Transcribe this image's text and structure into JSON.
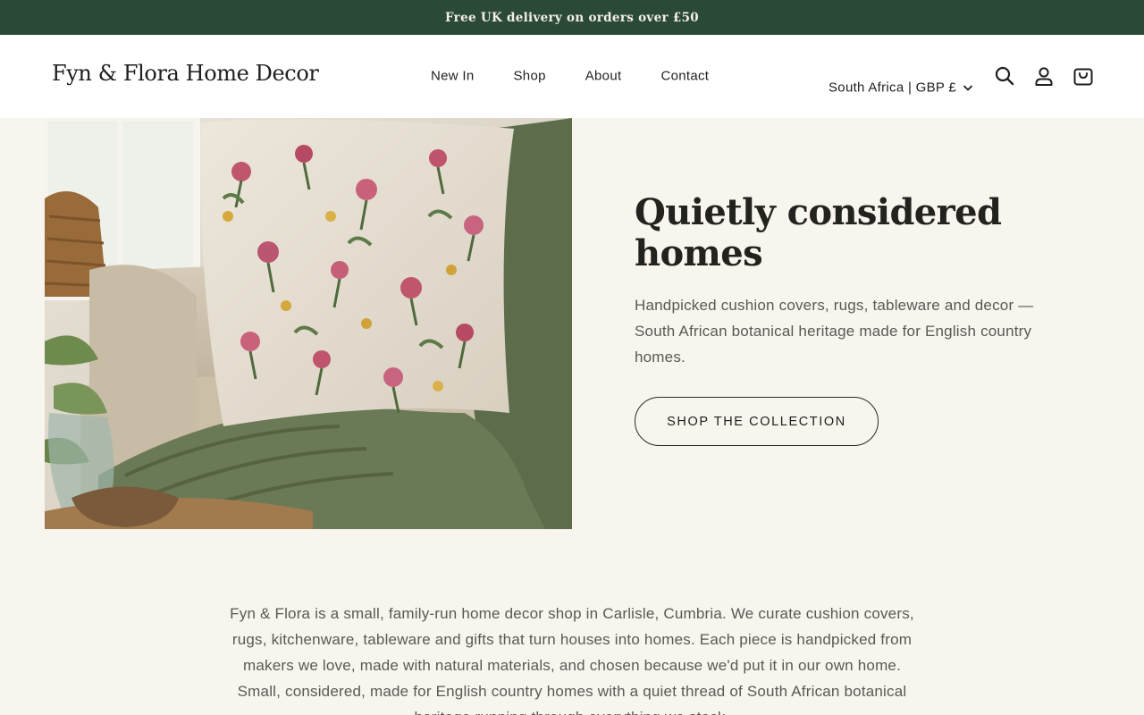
{
  "announcement": "Free UK delivery on orders over £50",
  "header": {
    "logo": "Fyn & Flora Home Decor",
    "nav": [
      "New In",
      "Shop",
      "About",
      "Contact"
    ],
    "locale": "South Africa | GBP £",
    "icons": [
      "search-icon",
      "account-icon",
      "cart-icon",
      "chevron-down-icon"
    ]
  },
  "hero": {
    "title": "Quietly considered homes",
    "description": "Handpicked cushion covers, rugs, tableware and decor — South African botanical heritage made for English country homes.",
    "cta": "SHOP THE COLLECTION"
  },
  "about": {
    "text": "Fyn & Flora is a small, family-run home decor shop in Carlisle, Cumbria. We curate cushion covers, rugs, kitchenware, tableware and gifts that turn houses into homes. Each piece is handpicked from makers we love, made with natural materials, and chosen because we'd put it in our own home. Small, considered, made for English country homes with a quiet thread of South African botanical heritage running through everything we stock."
  },
  "colors": {
    "announcement_bg": "#2a4a37",
    "page_bg": "#f8f4ee",
    "text_dark": "#1f1f1f",
    "text_muted": "#5b5955"
  }
}
